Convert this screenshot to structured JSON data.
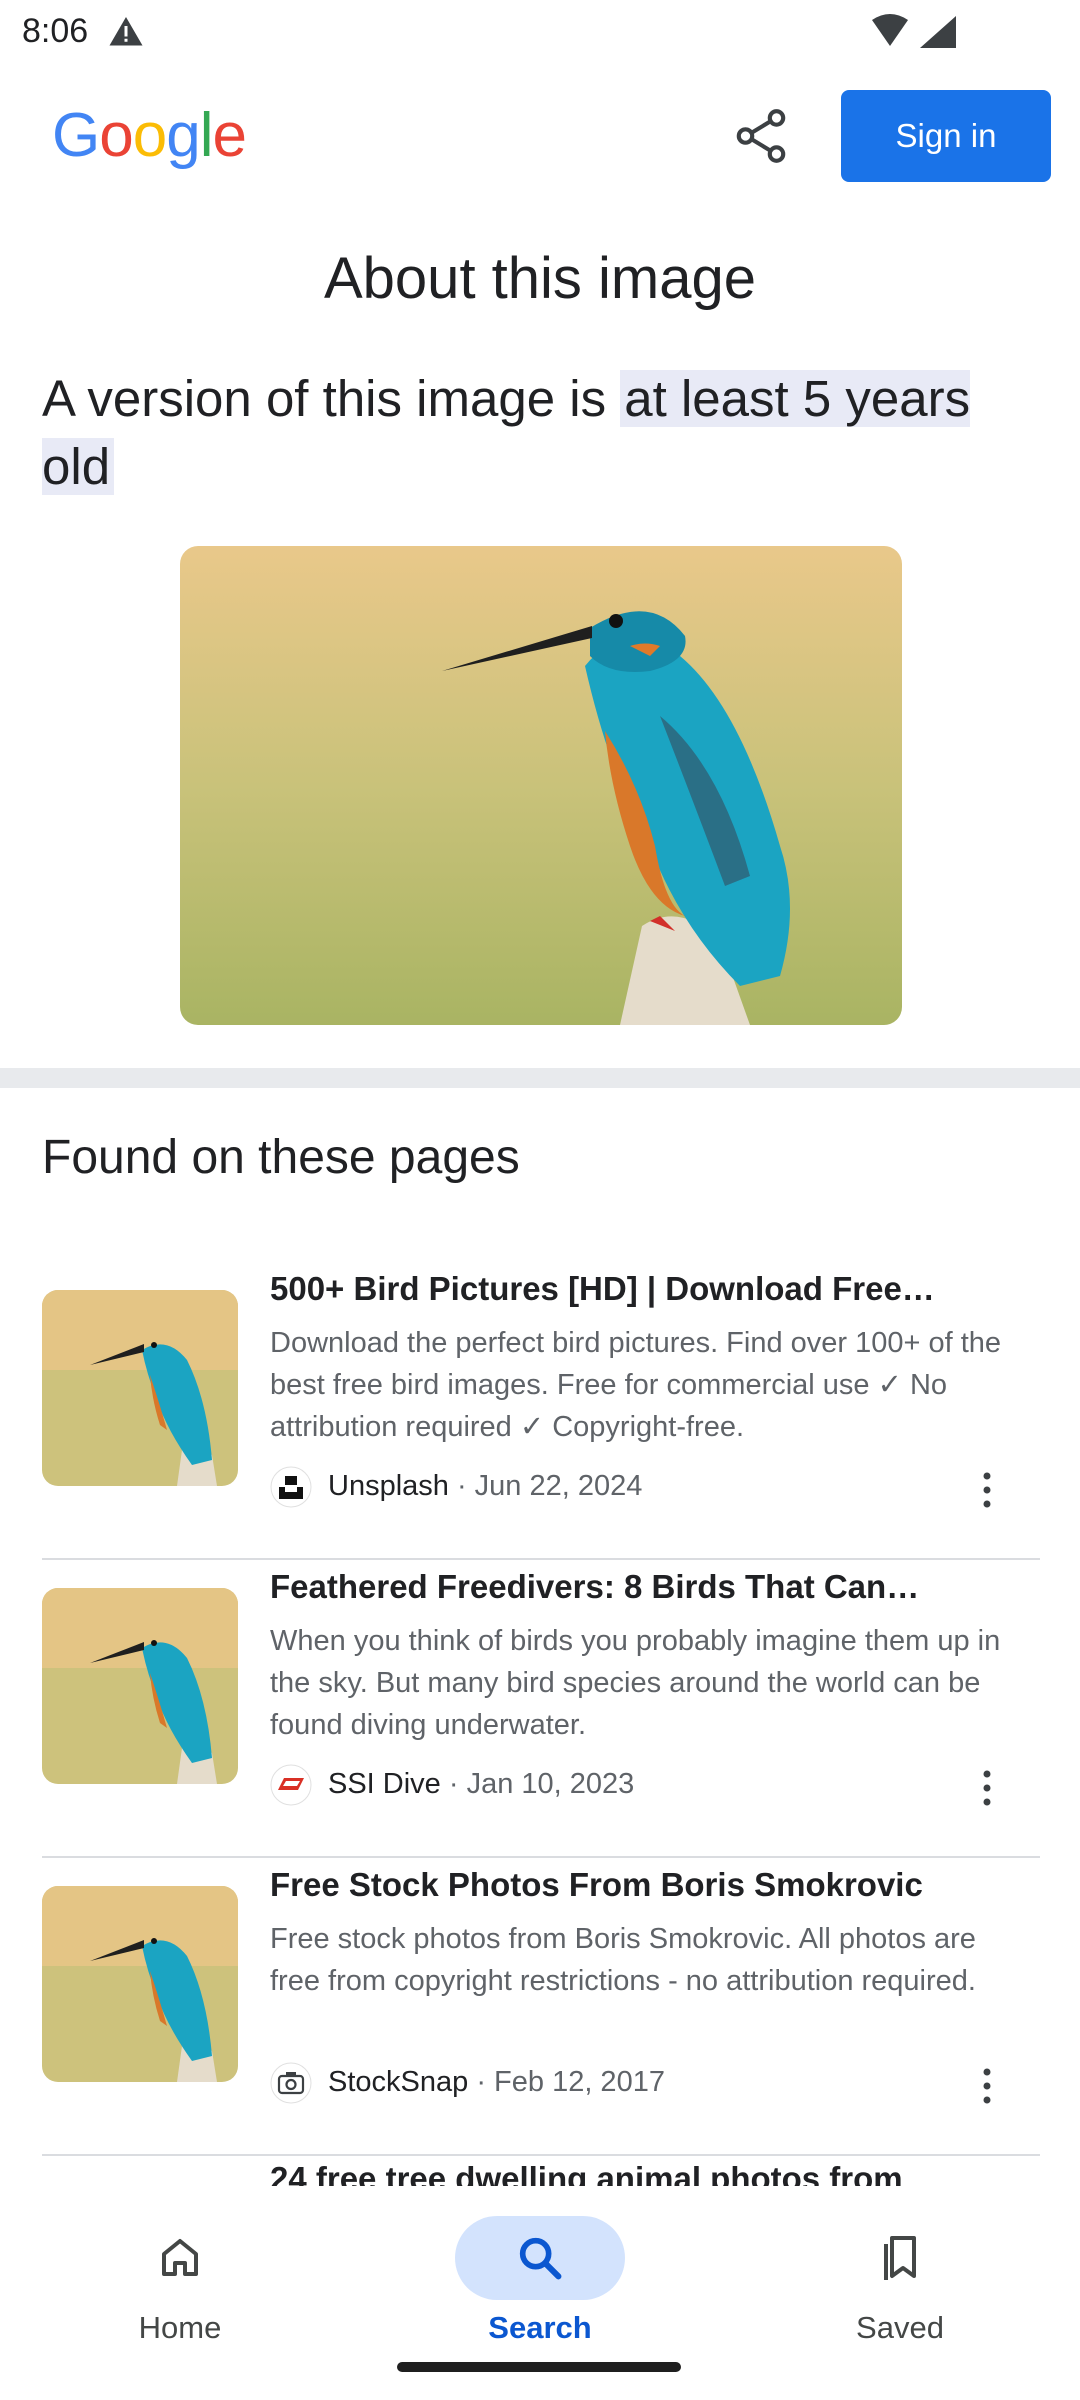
{
  "status_bar": {
    "time": "8:06"
  },
  "header": {
    "logo": [
      "G",
      "o",
      "o",
      "g",
      "l",
      "e"
    ],
    "sign_in_label": "Sign in"
  },
  "page_title": "About this image",
  "age": {
    "prefix": "A version of this image is ",
    "highlight": "at least 5 years old"
  },
  "section_title": "Found on these pages",
  "results": [
    {
      "title": "500+ Bird Pictures [HD] | Download Free…",
      "description": "Download the perfect bird pictures. Find over 100+ of the best free bird images. Free for commercial use ✓ No attribution required ✓ Copyright-free.",
      "source": "Unsplash",
      "date": " · Jun 22, 2024"
    },
    {
      "title": "Feathered Freedivers: 8 Birds That Can…",
      "description": "When you think of birds you probably imagine them up in the sky. But many bird species around the world can be found diving underwater.",
      "source": "SSI Dive",
      "date": " · Jan 10, 2023"
    },
    {
      "title": "Free Stock Photos From Boris Smokrovic",
      "description": "Free stock photos from Boris Smokrovic. All photos are free from copyright restrictions - no attribution required.",
      "source": "StockSnap",
      "date": " · Feb 12, 2017"
    }
  ],
  "peek_title": "24 free tree dwelling animal photos from",
  "bottom_nav": {
    "home": "Home",
    "search": "Search",
    "saved": "Saved"
  },
  "colors": {
    "accent": "#1a73e8",
    "nav_active_bg": "#d3e3fd",
    "highlight_bg": "#e8eaf6"
  }
}
